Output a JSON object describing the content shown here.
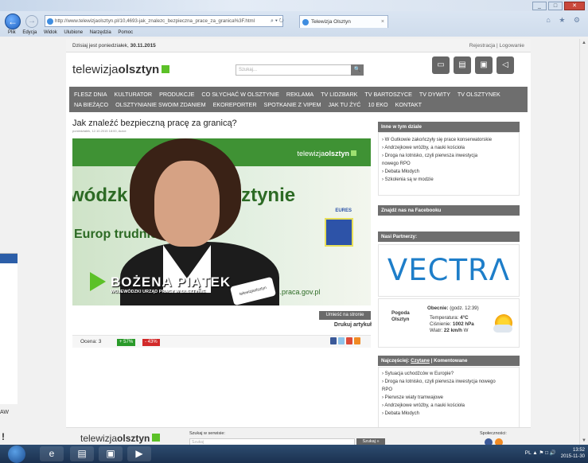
{
  "browser": {
    "url": "http://www.telewizjaolsztyn.pl/10,4693-jak_znalezc_bezpieczna_prace_za_granica%3F.html",
    "url_controls": "⌕ ▾ ↻",
    "tab_title": "Telewizja Olsztyn",
    "tab_close": "×",
    "menu": [
      "Plik",
      "Edycja",
      "Widok",
      "Ulubione",
      "Narzędzia",
      "Pomoc"
    ],
    "chrome_icons": "⌂ ★ ⚙"
  },
  "site": {
    "date_label": "Dzisiaj jest poniedziałek,",
    "date_value": "30.11.2015",
    "auth_links": "Rejestracja | Logowanie",
    "logo_light": "telewizja",
    "logo_bold": "olsztyn",
    "search_placeholder": "Szukaj...",
    "search_button": "🔍",
    "nav": [
      "FLESZ DNIA",
      "KULTURATOR",
      "PRODUKCJE",
      "CO SŁYCHAĆ W OLSZTYNIE",
      "REKLAMA",
      "TV LIDZBARK",
      "TV BARTOSZYCE",
      "TV DYWITY",
      "TV OLSZTYNEK",
      "NA BIEŻĄCO",
      "OLSZTYNIANIE SWOIM ZDANIEM",
      "EKOREPORTER",
      "SPOTKANIE Z VIPEM",
      "JAK TU ŻYĆ",
      "10 EKO",
      "KONTAKT"
    ]
  },
  "article": {
    "title": "Jak znaleźć bezpieczną pracę za granicą?",
    "meta": "poniedziałek, 12.10.2015 18:00, Autor:",
    "video": {
      "watermark_light": "telewizja",
      "watermark_bold": "olsztyn",
      "bg_text_1": "wódzk Pracy w Olsztynie",
      "bg_text_2": "Europ           trudnienia",
      "eures": "EURES",
      "website": "ures.praca.gov.pl",
      "mic_label": "telewizjaolsztyn",
      "caption_name": "BOŻENA PIĄTEK",
      "caption_role": "WOJEWÓDZKI URZĄD PRACY W OLSZTYNIE"
    },
    "embed_button": "Umieść na stronie",
    "print_link": "Drukuj artykuł",
    "rating_label": "Ocena: 3",
    "rating_plus": "+ 57%",
    "rating_minus": "- 43%"
  },
  "sidebar": {
    "related_heading": "Inne w tym dziale",
    "related": [
      "› W Gutkowie zakończyły się prace konserwatorskie",
      "› Andrzejkowe wróżby, a nauki kościoła",
      "› Droga na lotnisko, czyli pierwsza inwestycja",
      "nowego RPO",
      "› Debata Młodych",
      "› Szkolenia są w modzie"
    ],
    "facebook_heading": "Znajdź nas na Facebooku",
    "partners_heading": "Nasi Partnerzy:",
    "partner_logo": "VECTRΛ",
    "weather": {
      "city_line1": "Pogoda",
      "city_line2": "Olsztyn",
      "now_label": "Obecnie:",
      "now_time": "(godz. 12:39)",
      "temp_label": "Temperatura:",
      "temp_value": "4°C",
      "pressure_label": "Ciśnienie:",
      "pressure_value": "1002 hPa",
      "wind_label": "Wiatr:",
      "wind_value": "22 km/h",
      "wind_dir": "W"
    },
    "popular_tabs": {
      "lead": "Najczęściej:",
      "read": "Czytane",
      "sep": "|",
      "commented": "Komentowane"
    },
    "popular": [
      "› Sytuacja uchodźców w Europie?",
      "› Droga na lotnisko, czyli pierwsza inwestycja nowego",
      "RPO",
      "› Pierwsze wiaty tramwajowe",
      "› Andrzejkowe wróżby, a nauki kościoła",
      "› Debata Młodych"
    ]
  },
  "footer": {
    "logo_light": "telewizja",
    "logo_bold": "olsztyn",
    "search_label": "Szukaj w serwisie:",
    "search_placeholder": "Szukaj",
    "search_button": "Szukaj »",
    "social_label": "Społeczności:"
  },
  "ghost_window": {
    "text1": "AW",
    "text2": "!"
  },
  "taskbar": {
    "tray": "PL  ▲  ⚑  □  🔊",
    "time": "13:52",
    "date": "2015-11-30"
  },
  "colors": {
    "accent_green": "#5cc128",
    "nav_gray": "#6e6e6e",
    "vectra_blue": "#1e7ec9"
  }
}
